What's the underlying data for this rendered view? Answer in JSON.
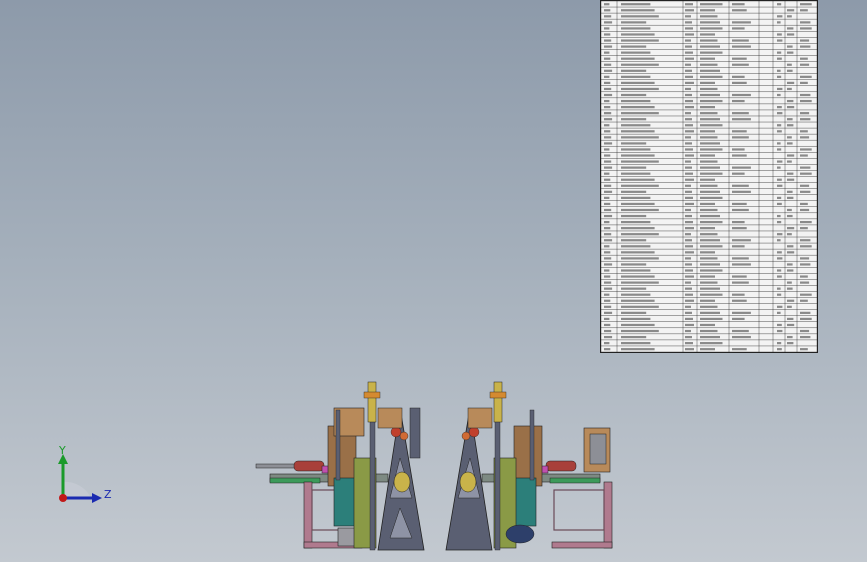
{
  "viewport": {
    "background_top": "#8d9aaa",
    "background_bottom": "#c3c9d0"
  },
  "bom": {
    "row_count": 58,
    "line_color": "#222222",
    "text_color": "#333333",
    "fill": "#f3f3f3"
  },
  "triad": {
    "y_label": "Y",
    "z_label": "Z",
    "y_color": "#1a9a2a",
    "z_color": "#1a2ab0",
    "x_color": "#c01818"
  },
  "assembly": {
    "colors": {
      "frame": "#5a5f72",
      "base_plate": "#7d8a82",
      "stand_pink": "#b07a8e",
      "olive": "#8a9a46",
      "teal": "#2c7f7a",
      "brown": "#9a7048",
      "red_motor": "#a8403a",
      "magenta": "#c050b0",
      "yellow": "#c9b34a",
      "gray": "#8d8f96"
    }
  }
}
